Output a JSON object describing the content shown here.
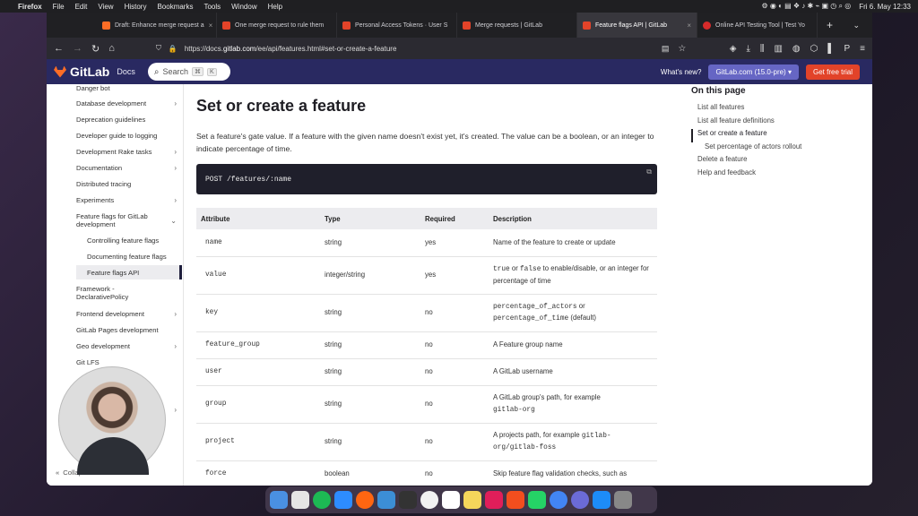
{
  "menubar": {
    "app": "Firefox",
    "items": [
      "File",
      "Edit",
      "View",
      "History",
      "Bookmarks",
      "Tools",
      "Window",
      "Help"
    ],
    "clock": "Fri 6. May  12:33"
  },
  "tabs": [
    {
      "label": "Draft: Enhance merge request a",
      "color": "#fc6d26"
    },
    {
      "label": "One merge request to rule them",
      "color": "#e24329"
    },
    {
      "label": "Personal Access Tokens · User S",
      "color": "#e24329"
    },
    {
      "label": "Merge requests | GitLab",
      "color": "#e24329"
    },
    {
      "label": "Feature flags API | GitLab",
      "color": "#e24329",
      "active": true
    },
    {
      "label": "Online API Testing Tool | Test Yo",
      "color": "#d62b2b"
    }
  ],
  "url": {
    "prefix": "https://docs.",
    "host": "gitlab.com",
    "path": "/ee/api/features.html#set-or-create-a-feature"
  },
  "gitlab_header": {
    "brand": "GitLab",
    "docs": "Docs",
    "search_placeholder": "Search",
    "search_kbd_1": "⌘",
    "search_kbd_2": "K",
    "whats_new": "What's new?",
    "version": "GitLab.com (15.0-pre)",
    "version_caret": "▾",
    "trial": "Get free trial"
  },
  "sidebar": {
    "items": [
      {
        "label": "Danger bot"
      },
      {
        "label": "Database development",
        "caret": "›"
      },
      {
        "label": "Deprecation guidelines"
      },
      {
        "label": "Developer guide to logging"
      },
      {
        "label": "Development Rake tasks",
        "caret": "›"
      },
      {
        "label": "Documentation",
        "caret": "›"
      },
      {
        "label": "Distributed tracing"
      },
      {
        "label": "Experiments",
        "caret": "›"
      },
      {
        "label": "Feature flags for GitLab development",
        "caret": "⌄"
      },
      {
        "label": "Controlling feature flags"
      },
      {
        "label": "Documenting feature flags"
      },
      {
        "label": "Feature flags API"
      },
      {
        "label": "Framework - DeclarativePolicy"
      },
      {
        "label": "Frontend development",
        "caret": "›"
      },
      {
        "label": "GitLab Pages development"
      },
      {
        "label": "Geo development",
        "caret": "›"
      },
      {
        "label": "Git LFS"
      }
    ],
    "hidden_caret": "›",
    "collapse": "Collapse sidebar",
    "collapse_icon": "«"
  },
  "main": {
    "title": "Set or create a feature",
    "intro": "Set a feature's gate value. If a feature with the given name doesn't exist yet, it's created. The value can be a boolean, or an integer to indicate percentage of time.",
    "code": "POST /features/:name",
    "copy_icon": "⧉",
    "headers": [
      "Attribute",
      "Type",
      "Required",
      "Description"
    ],
    "rows": [
      {
        "attr": "name",
        "type": "string",
        "req": "yes",
        "desc": "Name of the feature to create or update"
      },
      {
        "attr": "value",
        "type": "integer/string",
        "req": "yes",
        "desc_a": "true",
        "desc_b": " or ",
        "desc_c": "false",
        "desc_d": " to enable/disable, or an integer for percentage of time"
      },
      {
        "attr": "key",
        "type": "string",
        "req": "no",
        "desc_a": "percentage_of_actors",
        "desc_b": " or",
        "desc_c": "percentage_of_time",
        "desc_d": " (default)"
      },
      {
        "attr": "feature_group",
        "type": "string",
        "req": "no",
        "desc": "A Feature group name"
      },
      {
        "attr": "user",
        "type": "string",
        "req": "no",
        "desc": "A GitLab username"
      },
      {
        "attr": "group",
        "type": "string",
        "req": "no",
        "desc_a": "A GitLab group's path, for example",
        "desc_c": "gitlab-org"
      },
      {
        "attr": "project",
        "type": "string",
        "req": "no",
        "desc_a": "A projects path, for example ",
        "desc_c": "gitlab-org/gitlab-foss"
      },
      {
        "attr": "force",
        "type": "boolean",
        "req": "no",
        "desc": "Skip feature flag validation checks, such as"
      }
    ]
  },
  "toc": {
    "title": "On this page",
    "items": [
      {
        "label": "List all features"
      },
      {
        "label": "List all feature definitions"
      },
      {
        "label": "Set or create a feature",
        "active": true
      },
      {
        "label": "Set percentage of actors rollout",
        "sub": true
      },
      {
        "label": "Delete a feature"
      },
      {
        "label": "Help and feedback"
      }
    ]
  },
  "dock": [
    "#4a90e2",
    "#e5e5e5",
    "#1db954",
    "#2d8cff",
    "#ff6611",
    "#3c8ed6",
    "#333333",
    "#f2f2f2",
    "#ffffff",
    "#f5d65b",
    "#e01e5a",
    "#f24e1e",
    "#25d366",
    "#4285f4",
    "#6b6bd6",
    "#1d8cf8",
    "#888888"
  ]
}
